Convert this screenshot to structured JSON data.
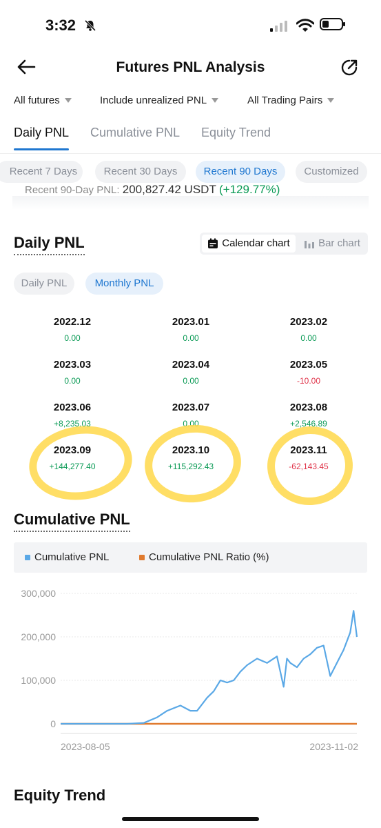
{
  "status_bar": {
    "time": "3:32"
  },
  "header": {
    "title": "Futures PNL Analysis"
  },
  "filters": [
    {
      "label": "All futures"
    },
    {
      "label": "Include unrealized PNL"
    },
    {
      "label": "All Trading Pairs"
    }
  ],
  "tabs": [
    {
      "label": "Daily PNL",
      "active": true
    },
    {
      "label": "Cumulative PNL",
      "active": false
    },
    {
      "label": "Equity Trend",
      "active": false
    }
  ],
  "range_pills": [
    {
      "label": "Recent 7 Days",
      "active": false
    },
    {
      "label": "Recent 30 Days",
      "active": false
    },
    {
      "label": "Recent 90 Days",
      "active": true
    },
    {
      "label": "Customized",
      "active": false
    }
  ],
  "summary": {
    "label": "Recent 90-Day PNL:",
    "value": "200,827.42 USDT",
    "pct": "(+129.77%)"
  },
  "daily_section": {
    "title": "Daily PNL",
    "view_toggle": {
      "calendar": "Calendar chart",
      "bar": "Bar chart"
    },
    "sub_tabs": [
      {
        "label": "Daily PNL",
        "active": false
      },
      {
        "label": "Monthly PNL",
        "active": true
      }
    ],
    "months": [
      {
        "month": "2022.12",
        "value": "0.00",
        "sign": "zero"
      },
      {
        "month": "2023.01",
        "value": "0.00",
        "sign": "zero"
      },
      {
        "month": "2023.02",
        "value": "0.00",
        "sign": "zero"
      },
      {
        "month": "2023.03",
        "value": "0.00",
        "sign": "zero"
      },
      {
        "month": "2023.04",
        "value": "0.00",
        "sign": "zero"
      },
      {
        "month": "2023.05",
        "value": "-10.00",
        "sign": "neg"
      },
      {
        "month": "2023.06",
        "value": "+8,235.03",
        "sign": "pos"
      },
      {
        "month": "2023.07",
        "value": "0.00",
        "sign": "zero"
      },
      {
        "month": "2023.08",
        "value": "+2,546.89",
        "sign": "pos"
      },
      {
        "month": "2023.09",
        "value": "+144,277.40",
        "sign": "pos"
      },
      {
        "month": "2023.10",
        "value": "+115,292.43",
        "sign": "pos"
      },
      {
        "month": "2023.11",
        "value": "-62,143.45",
        "sign": "neg"
      }
    ]
  },
  "cumulative_section": {
    "title": "Cumulative PNL",
    "legend": [
      {
        "label": "Cumulative PNL",
        "color": "#5aa8e6"
      },
      {
        "label": "Cumulative PNL Ratio (%)",
        "color": "#e07a2e"
      }
    ]
  },
  "equity_section": {
    "title": "Equity Trend"
  },
  "chart_data": {
    "type": "line",
    "title": "",
    "xlabel": "",
    "ylabel": "",
    "x_tick_labels": [
      "2023-08-05",
      "2023-11-02"
    ],
    "y_tick_labels": [
      "300,000",
      "200,000",
      "100,000",
      "0"
    ],
    "ylim": [
      0,
      300000
    ],
    "x": [
      "2023-08-05",
      "2023-08-15",
      "2023-08-25",
      "2023-08-30",
      "2023-09-03",
      "2023-09-06",
      "2023-09-10",
      "2023-09-13",
      "2023-09-15",
      "2023-09-18",
      "2023-09-20",
      "2023-09-22",
      "2023-09-24",
      "2023-09-26",
      "2023-09-28",
      "2023-09-30",
      "2023-10-03",
      "2023-10-06",
      "2023-10-09",
      "2023-10-11",
      "2023-10-12",
      "2023-10-13",
      "2023-10-15",
      "2023-10-17",
      "2023-10-19",
      "2023-10-21",
      "2023-10-23",
      "2023-10-25",
      "2023-10-27",
      "2023-10-29",
      "2023-10-31",
      "2023-11-01",
      "2023-11-02"
    ],
    "series": [
      {
        "name": "Cumulative PNL",
        "color": "#5aa8e6",
        "values": [
          0,
          0,
          0,
          2000,
          15000,
          30000,
          42000,
          30000,
          30000,
          60000,
          75000,
          100000,
          95000,
          100000,
          120000,
          135000,
          150000,
          140000,
          155000,
          85000,
          150000,
          140000,
          130000,
          150000,
          160000,
          175000,
          180000,
          110000,
          140000,
          170000,
          210000,
          260000,
          200000
        ]
      },
      {
        "name": "Cumulative PNL Ratio (%)",
        "color": "#e07a2e",
        "values": [
          0,
          0,
          0,
          0,
          0,
          0,
          0,
          0,
          0,
          0,
          0,
          0,
          0,
          0,
          0,
          0,
          0,
          0,
          0,
          0,
          0,
          0,
          0,
          0,
          0,
          0,
          0,
          0,
          0,
          0,
          0,
          0,
          0
        ]
      }
    ],
    "grid": true,
    "legend": "top"
  }
}
